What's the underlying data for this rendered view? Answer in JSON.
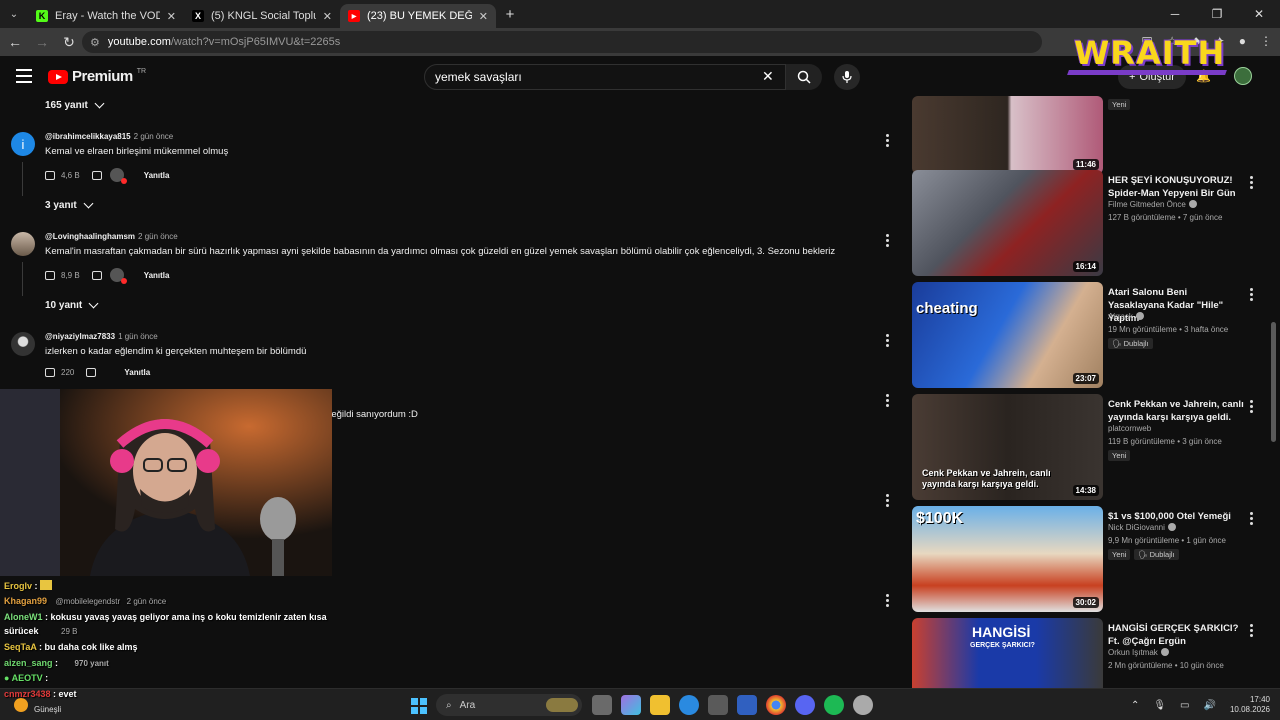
{
  "browser": {
    "tabs": [
      {
        "label": "Eray - Watch the VOD on Kick",
        "icon": "K",
        "icon_color": "#53fc18",
        "active": false
      },
      {
        "label": "(5) KNGL Social Topluluk / X",
        "icon": "X",
        "icon_color": "#000000",
        "active": false
      },
      {
        "label": "(23) BU YEMEK DEĞİL ADETA ŞÖ",
        "icon": "▶",
        "icon_color": "#ff0000",
        "active": true
      }
    ],
    "url_host": "youtube.com",
    "url_path": "/watch?v=mOsjP65IMVU&t=2265s"
  },
  "overlay_logo": "WRAITH",
  "youtube": {
    "logo_word": "Premium",
    "country_code": "TR",
    "search_value": "yemek savaşları",
    "create_label": "Oluştur"
  },
  "comments": [
    {
      "replies_label": "165 yanıt"
    },
    {
      "author": "@ibrahimcelikkaya815",
      "time": "2 gün önce",
      "text": "Kemal ve elraen birleşimi mükemmel olmuş",
      "likes": "4,6 B",
      "reply_label": "Yanıtla",
      "replies_label": "3 yanıt",
      "avatar_color": "#1e88e5",
      "avatar_letter": "i"
    },
    {
      "author": "@Lovinghaalinghamsm",
      "time": "2 gün önce",
      "text": "Kemal'in masraftan çakmadan bir sürü hazırlık yapması ayni şekilde babasının da yardımcı olması çok güzeldi en güzel yemek savaşları bölümü olabilir çok eğlenceliydi, 3. Sezonu bekleriz",
      "likes": "8,9 B",
      "reply_label": "Yanıtla",
      "replies_label": "10 yanıt",
      "avatar_color": "#8a8a8a"
    },
    {
      "author": "@niyaziylmaz7833",
      "time": "1 gün önce",
      "text": "izlerken o kadar eğlendim ki gerçekten muhteşem bir bölümdü",
      "likes": "220",
      "reply_label": "Yanıtla",
      "avatar_color": "#5a5a5a"
    }
  ],
  "partial_comment_text": "di değildi sanıyordum :D",
  "hidden_comment": {
    "author": "@mobilelegendstr",
    "time": "2 gün önce",
    "text": "kokusu yavaş yavaş geliyor ama inş o koku temizlenir zaten kısa",
    "likes": "29 B",
    "replies_label": "970 yanıt"
  },
  "recommendations": [
    {
      "title": "",
      "channel": "",
      "stats": "",
      "duration": "11:46",
      "badge": "Yeni",
      "thumb_colors": [
        "#3a2f2a",
        "#c46a7a"
      ]
    },
    {
      "title": "HER ŞEYİ KONUŞUYORUZ! Spider-Man Yepyeni Bir Gün",
      "channel": "Filme Gitmeden Önce",
      "stats": "127 B görüntüleme • 7 gün önce",
      "duration": "16:14",
      "thumb_colors": [
        "#6a6e78",
        "#a42828"
      ]
    },
    {
      "title": "Atari Salonu Beni Yasaklayana Kadar \"Hile\" Yaptım",
      "channel": "Airrack",
      "stats": "19 Mn görüntüleme • 3 hafta önce",
      "duration": "23:07",
      "badge_dub": "Dublajlı",
      "thumb_label": "cheating",
      "thumb_colors": [
        "#1c4aa8",
        "#d0b090"
      ]
    },
    {
      "title": "Cenk Pekkan ve Jahrein, canlı yayında karşı karşıya geldi.",
      "channel": "platcornweb",
      "stats": "119 B görüntüleme • 3 gün önce",
      "duration": "14:38",
      "badge": "Yeni",
      "thumb_label": "Cenk Pekkan ve Jahrein, canlı yayında karşı karşıya geldi.",
      "thumb_colors": [
        "#2a2420",
        "#5a4a3e"
      ]
    },
    {
      "title": "$1 vs $100,000 Otel Yemeği",
      "channel": "Nick DiGiovanni",
      "stats": "9,9 Mn görüntüleme • 1 gün önce",
      "duration": "30:02",
      "badge": "Yeni",
      "badge_dub": "Dublajlı",
      "thumb_label": "$100K",
      "thumb_colors": [
        "#5aa0d8",
        "#d8a030"
      ]
    },
    {
      "title": "HANGİSİ GERÇEK ŞARKICI? Ft. @Çağrı Ergün",
      "channel": "Orkun Işıtmak",
      "stats": "2 Mn görüntüleme • 10 gün önce",
      "duration": "",
      "thumb_label": "HANGİSİ",
      "thumb_sub": "GERÇEK ŞARKICI?",
      "thumb_colors": [
        "#1a3aa8",
        "#d84030"
      ]
    }
  ],
  "chat": [
    {
      "user": "Eroglv",
      "msg": "",
      "color": "#e8c540"
    },
    {
      "user": "Khagan99",
      "msg": "",
      "color": "#e2a040"
    },
    {
      "user": "AloneW1",
      "msg": "kokusu yavaş yavaş geliyor ama inş o koku temizlenir zaten kısa",
      "color": "#7be07b"
    },
    {
      "user": "",
      "msg": "sürücek",
      "color": "#ffffff"
    },
    {
      "user": "SeqTaA",
      "msg": "bu daha cok like almş",
      "color": "#e8c540"
    },
    {
      "user": "aizen_sang",
      "msg": "",
      "color": "#6fd86f"
    },
    {
      "user": "AEOTV",
      "msg": "",
      "color": "#66e066"
    },
    {
      "user": "cnmzr3438",
      "msg": "evet",
      "color": "#e03a3a"
    }
  ],
  "taskbar": {
    "weather_label": "Güneşli",
    "search_label": "Ara",
    "time": "17:40",
    "date": "10.08.2026",
    "app_colors": [
      "#6a6a6a",
      "#a070e0",
      "#f0c030",
      "#2a8ae0",
      "#5a5a5a",
      "#3060c0",
      "#f0c030",
      "#5865f2",
      "#1db954",
      "#aaaaaa"
    ]
  }
}
